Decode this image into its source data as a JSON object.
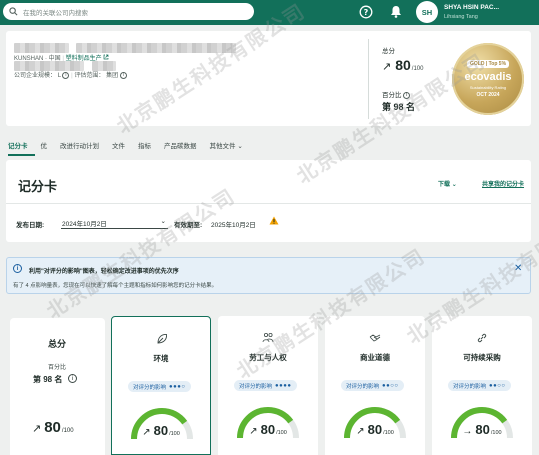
{
  "topbar": {
    "search_placeholder": "在我的关联公司内搜索",
    "avatar_initials": "SH",
    "company_name": "SHYA HSIN PAC...",
    "company_sub": "Lihsiang Tang"
  },
  "header": {
    "location": "KUNSHAN · 中国",
    "sector": "塑料制品生产",
    "size_label": "公司企业规模：",
    "size_value": "L",
    "scope_label": "评估范围：",
    "scope_value": "集团",
    "total_label": "总分",
    "score": "80",
    "score_den": "/100",
    "percentile_label": "百分比",
    "rank": "第 98 名",
    "medal": {
      "tier": "GOLD | Top 5%",
      "brand": "ecovadis",
      "sub": "Sustainability Rating",
      "date": "OCT 2024"
    }
  },
  "tabs": [
    "记分卡",
    "优",
    "改进行动计划",
    "文件",
    "指标",
    "产品碳数据",
    "其他文件"
  ],
  "scorecard": {
    "title": "记分卡",
    "download": "下载",
    "share": "共享我的记分卡",
    "publish_label": "发布日期:",
    "publish_value": "2024年10月2日",
    "valid_label": "有效期至:",
    "valid_value": "2025年10月2日"
  },
  "banner": {
    "title": "利用\"对评分的影响\"图表，轻松确定改进事项的优先次序",
    "desc": "有了 4 点影响量表，您现在可以快速了解每个主题和指标如何影响您的记分卡结果。"
  },
  "summary": {
    "total_label": "总分",
    "percentile_label": "百分比",
    "rank": "第 98 名",
    "score": "80",
    "score_den": "/100"
  },
  "themes": [
    {
      "name": "环境",
      "impact_label": "对评分的影响",
      "impact_dots": "●●●○",
      "score": "80",
      "score_den": "/100",
      "arrow": "↗",
      "fill": 0.8
    },
    {
      "name": "劳工与人权",
      "impact_label": "对评分的影响",
      "impact_dots": "●●●●",
      "score": "80",
      "score_den": "/100",
      "arrow": "↗",
      "fill": 0.8
    },
    {
      "name": "商业道德",
      "impact_label": "对评分的影响",
      "impact_dots": "●●○○",
      "score": "80",
      "score_den": "/100",
      "arrow": "↗",
      "fill": 0.8
    },
    {
      "name": "可持续采购",
      "impact_label": "对评分的影响",
      "impact_dots": "●●○○",
      "score": "80",
      "score_den": "/100",
      "arrow": "→",
      "fill": 0.8
    }
  ],
  "watermark": "北京鹏生科技有限公司",
  "colors": {
    "brand": "#12705a",
    "gauge": "#5cb531",
    "info": "#1b5fa0",
    "gold": "#c7a65a"
  }
}
